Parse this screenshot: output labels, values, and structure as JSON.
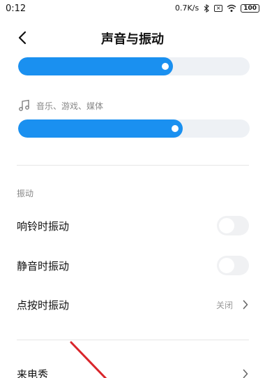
{
  "status_bar": {
    "time": "0:12",
    "speed": "0.7K/s",
    "battery": "100",
    "icons": [
      "bluetooth-icon",
      "box-x-icon",
      "wifi-icon",
      "battery-icon"
    ]
  },
  "header": {
    "title": "声音与振动",
    "back_icon": "chevron-left-icon"
  },
  "sliders": {
    "top_volume_level": 0.67,
    "media_volume_level": 0.71,
    "media_label": "音乐、游戏、媒体",
    "media_icon": "music-note-icon"
  },
  "vibration_section": {
    "title": "振动",
    "items": [
      {
        "label": "响铃时振动",
        "type": "toggle",
        "on": false
      },
      {
        "label": "静音时振动",
        "type": "toggle",
        "on": false
      },
      {
        "label": "点按时振动",
        "type": "link",
        "value": "关闭"
      }
    ]
  },
  "more_items": [
    {
      "label": "来电秀",
      "type": "link"
    }
  ],
  "colors": {
    "accent": "#1a90f0",
    "track": "#eef1f5",
    "annotation": "#d9252b"
  }
}
